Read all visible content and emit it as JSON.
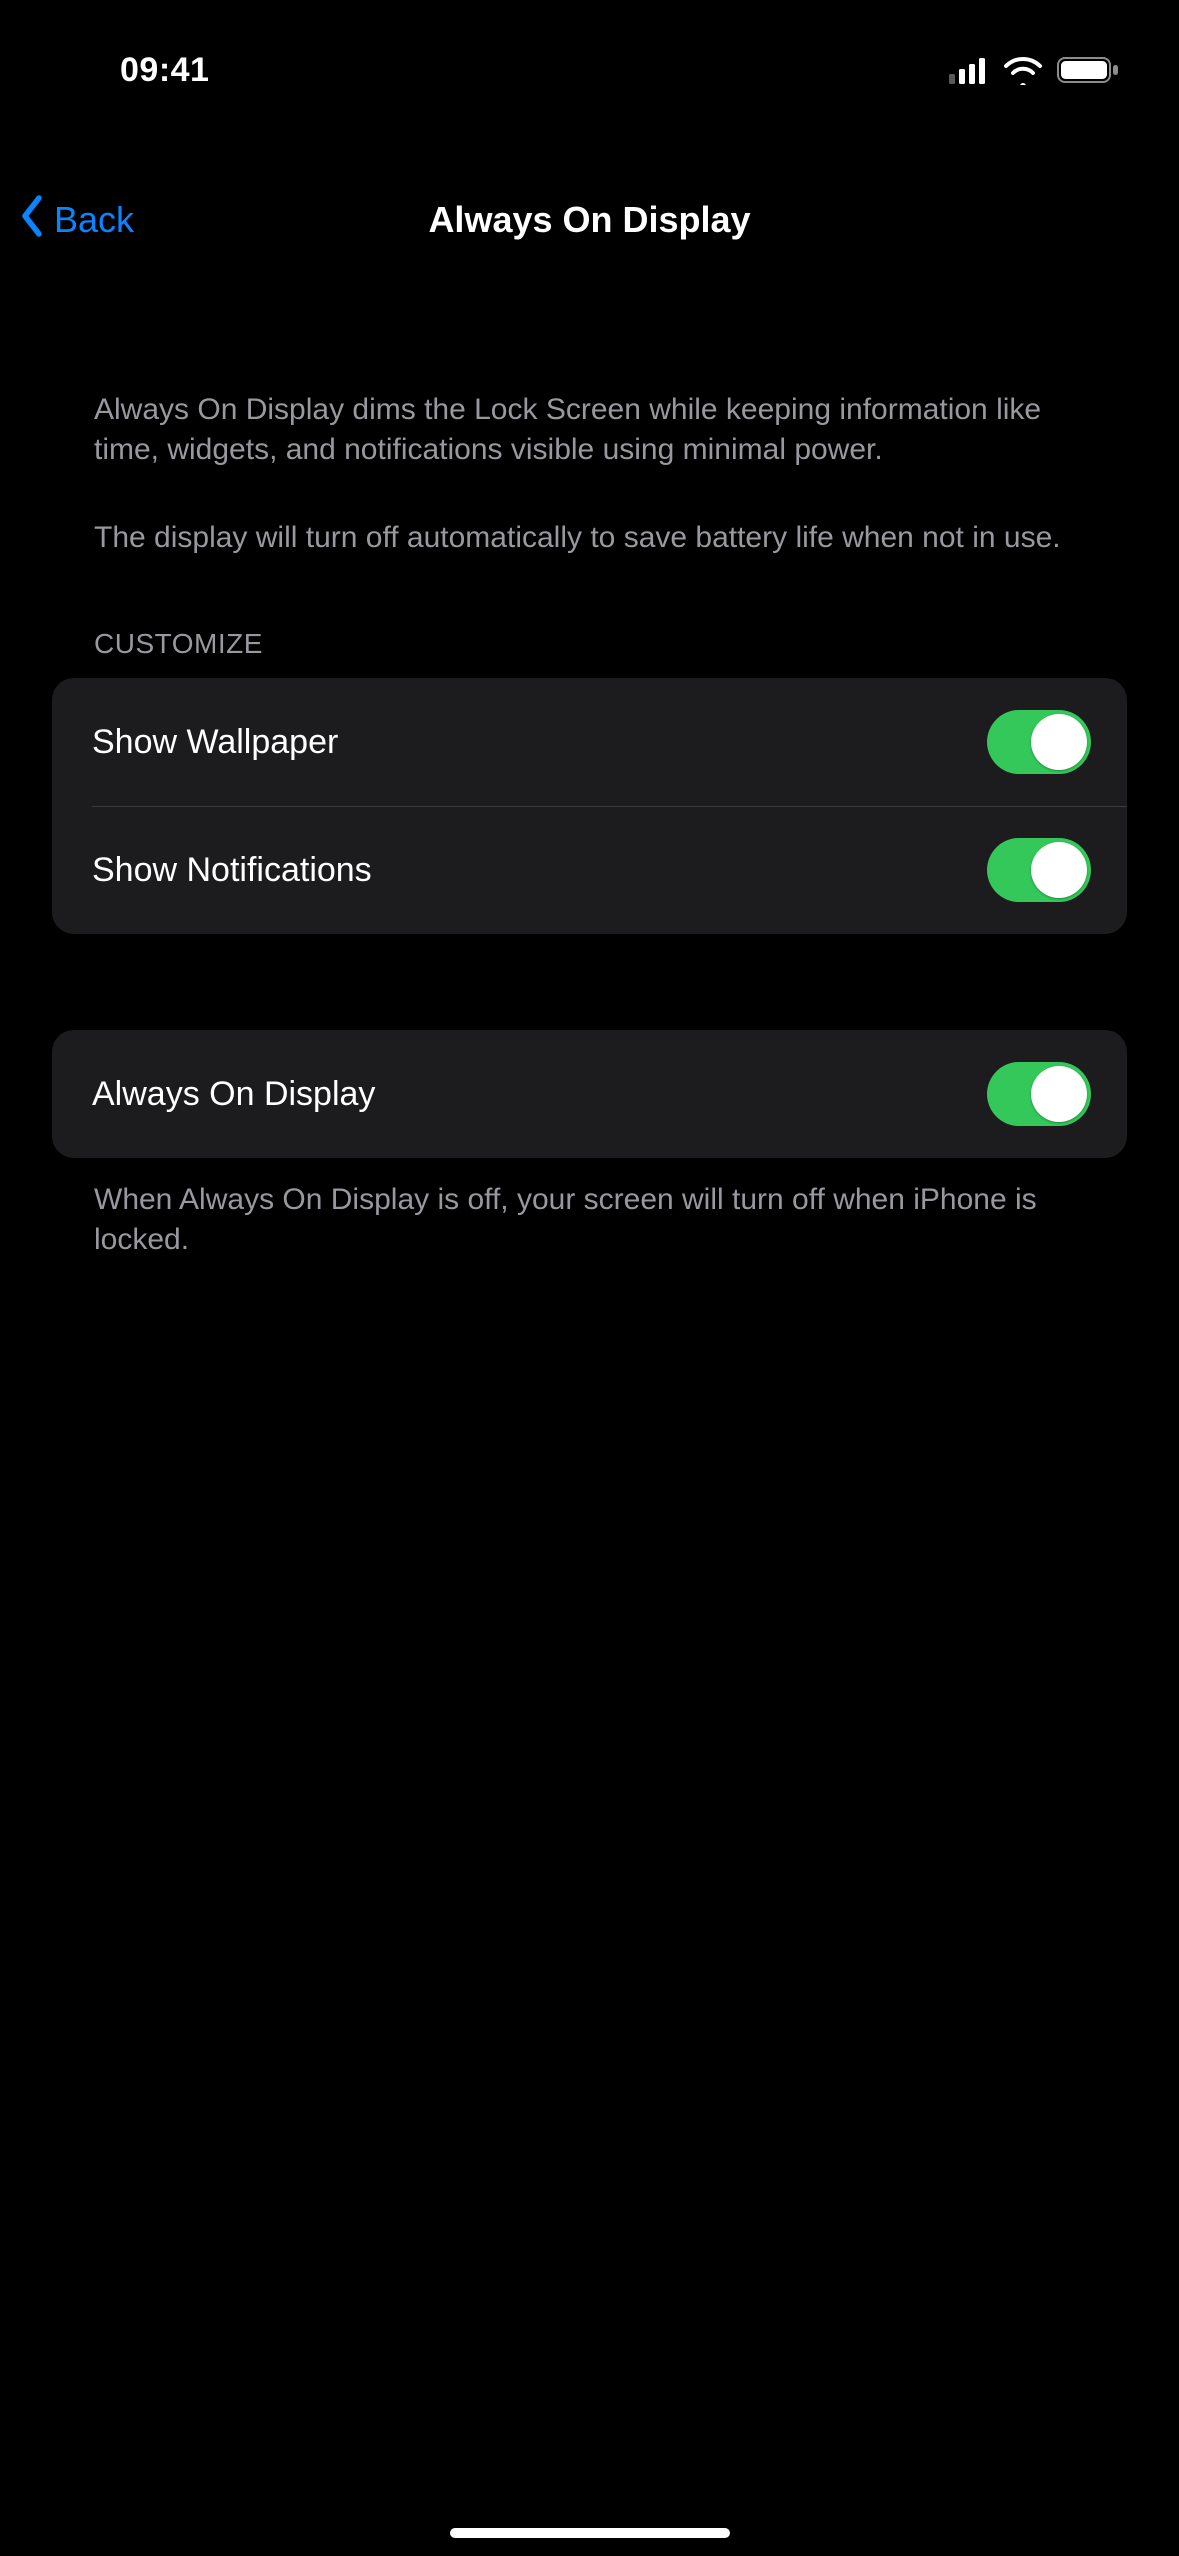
{
  "status": {
    "time": "09:41"
  },
  "nav": {
    "back_label": "Back",
    "title": "Always On Display"
  },
  "description": {
    "para1": "Always On Display dims the Lock Screen while keeping information like time, widgets, and notifications visible using minimal power.",
    "para2": "The display will turn off automatically to save battery life when not in use."
  },
  "sections": {
    "customize_header": "CUSTOMIZE",
    "customize": [
      {
        "label": "Show Wallpaper",
        "on": true
      },
      {
        "label": "Show Notifications",
        "on": true
      }
    ],
    "main": [
      {
        "label": "Always On Display",
        "on": true
      }
    ],
    "main_footer": "When Always On Display is off, your screen will turn off when iPhone is locked."
  },
  "colors": {
    "accent": "#0a84ff",
    "switch_on": "#34c759",
    "cell_bg": "#1c1c1e",
    "secondary_text": "#98989f"
  }
}
